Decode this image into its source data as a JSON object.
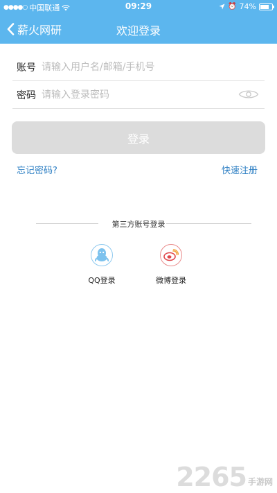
{
  "status_bar": {
    "carrier": "中国联通",
    "time": "09:29",
    "battery": "74%",
    "battery_level": 0.74
  },
  "navbar": {
    "back_label": "薪火网研",
    "title": "欢迎登录"
  },
  "form": {
    "account_label": "账号",
    "account_placeholder": "请输入用户名/邮箱/手机号",
    "password_label": "密码",
    "password_placeholder": "请输入登录密码",
    "login_label": "登录"
  },
  "links": {
    "forgot": "忘记密码?",
    "register": "快速注册"
  },
  "third_party": {
    "title": "第三方账号登录",
    "items": [
      {
        "label": "QQ登录",
        "icon": "qq-icon"
      },
      {
        "label": "微博登录",
        "icon": "weibo-icon"
      }
    ]
  },
  "watermark": {
    "number": "2265",
    "text": "手游网"
  },
  "colors": {
    "primary": "#5cb6ee",
    "link": "#2f80c4",
    "button_disabled": "#dcdcdc"
  }
}
